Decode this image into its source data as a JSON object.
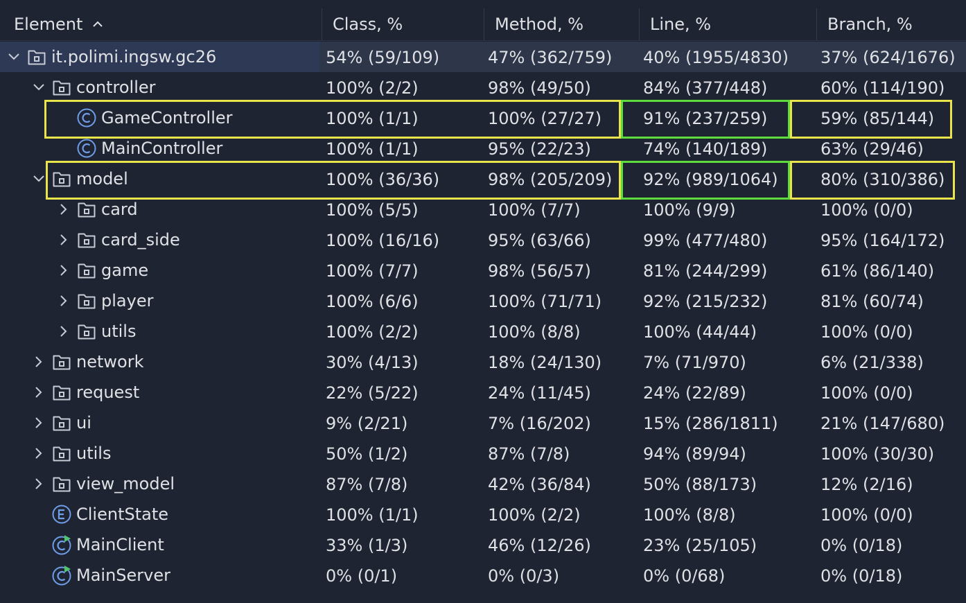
{
  "header": {
    "element": "Element",
    "class": "Class, %",
    "method": "Method, %",
    "line": "Line, %",
    "branch": "Branch, %"
  },
  "rows": [
    {
      "name": "it.polimi.ingsw.gc26",
      "icon": "package-icon",
      "expanded": true,
      "level": 0,
      "class": "54% (59/109)",
      "method": "47% (362/759)",
      "line": "40% (1955/4830)",
      "branch": "37% (624/1676)"
    },
    {
      "name": "controller",
      "icon": "package-icon",
      "expanded": true,
      "level": 1,
      "class": "100% (2/2)",
      "method": "98% (49/50)",
      "line": "84% (377/448)",
      "branch": "60% (114/190)"
    },
    {
      "name": "GameController",
      "icon": "class-icon",
      "level": 2,
      "class": "100% (1/1)",
      "method": "100% (27/27)",
      "line": "91% (237/259)",
      "branch": "59% (85/144)"
    },
    {
      "name": "MainController",
      "icon": "class-icon",
      "level": 2,
      "class": "100% (1/1)",
      "method": "95% (22/23)",
      "line": "74% (140/189)",
      "branch": "63% (29/46)"
    },
    {
      "name": "model",
      "icon": "package-icon",
      "expanded": true,
      "level": 1,
      "class": "100% (36/36)",
      "method": "98% (205/209)",
      "line": "92% (989/1064)",
      "branch": "80% (310/386)"
    },
    {
      "name": "card",
      "icon": "package-icon",
      "expanded": false,
      "level": 2,
      "class": "100% (5/5)",
      "method": "100% (7/7)",
      "line": "100% (9/9)",
      "branch": "100% (0/0)"
    },
    {
      "name": "card_side",
      "icon": "package-icon",
      "expanded": false,
      "level": 2,
      "class": "100% (16/16)",
      "method": "95% (63/66)",
      "line": "99% (477/480)",
      "branch": "95% (164/172)"
    },
    {
      "name": "game",
      "icon": "package-icon",
      "expanded": false,
      "level": 2,
      "class": "100% (7/7)",
      "method": "98% (56/57)",
      "line": "81% (244/299)",
      "branch": "61% (86/140)"
    },
    {
      "name": "player",
      "icon": "package-icon",
      "expanded": false,
      "level": 2,
      "class": "100% (6/6)",
      "method": "100% (71/71)",
      "line": "92% (215/232)",
      "branch": "81% (60/74)"
    },
    {
      "name": "utils",
      "icon": "package-icon",
      "expanded": false,
      "level": 2,
      "class": "100% (2/2)",
      "method": "100% (8/8)",
      "line": "100% (44/44)",
      "branch": "100% (0/0)"
    },
    {
      "name": "network",
      "icon": "package-icon",
      "expanded": false,
      "level": 1,
      "class": "30% (4/13)",
      "method": "18% (24/130)",
      "line": "7% (71/970)",
      "branch": "6% (21/338)"
    },
    {
      "name": "request",
      "icon": "package-icon",
      "expanded": false,
      "level": 1,
      "class": "22% (5/22)",
      "method": "24% (11/45)",
      "line": "24% (22/89)",
      "branch": "100% (0/0)"
    },
    {
      "name": "ui",
      "icon": "package-icon",
      "expanded": false,
      "level": 1,
      "class": "9% (2/21)",
      "method": "7% (16/202)",
      "line": "15% (286/1811)",
      "branch": "21% (147/680)"
    },
    {
      "name": "utils",
      "icon": "package-icon",
      "expanded": false,
      "level": 1,
      "class": "50% (1/2)",
      "method": "87% (7/8)",
      "line": "94% (89/94)",
      "branch": "100% (30/30)"
    },
    {
      "name": "view_model",
      "icon": "package-icon",
      "expanded": false,
      "level": 1,
      "class": "87% (7/8)",
      "method": "42% (36/84)",
      "line": "50% (88/173)",
      "branch": "12% (2/16)"
    },
    {
      "name": "ClientState",
      "icon": "enum-icon",
      "level": 1,
      "class": "100% (1/1)",
      "method": "100% (2/2)",
      "line": "100% (8/8)",
      "branch": "100% (0/0)"
    },
    {
      "name": "MainClient",
      "icon": "runnable-class-icon",
      "level": 1,
      "class": "33% (1/3)",
      "method": "46% (12/26)",
      "line": "23% (25/105)",
      "branch": "0% (0/18)"
    },
    {
      "name": "MainServer",
      "icon": "runnable-class-icon",
      "level": 1,
      "class": "0% (0/1)",
      "method": "0% (0/3)",
      "line": "0% (0/68)",
      "branch": "0% (0/18)"
    }
  ],
  "colors": {
    "background": "#1f2433",
    "selected_row": "#2e364a",
    "text": "#dfe1e5",
    "highlight_yellow": "#e8e34a",
    "highlight_green": "#5fdc3c",
    "icon_blue": "#6f9ee8"
  }
}
